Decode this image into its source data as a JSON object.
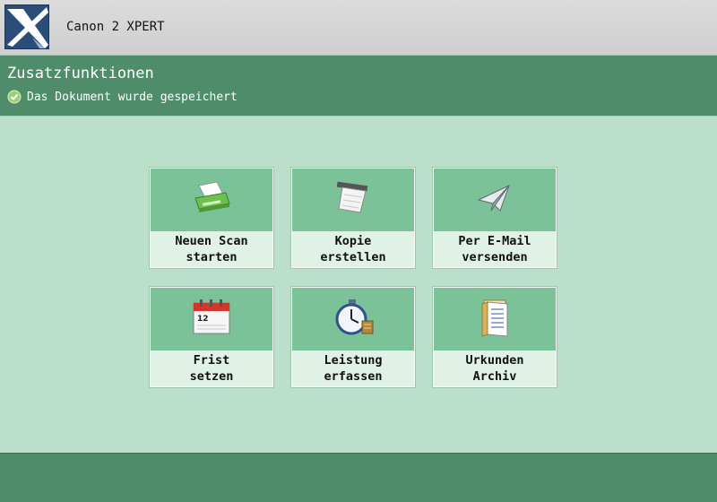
{
  "app": {
    "title": "Canon 2 XPERT",
    "logo_icon": "x-logo-icon"
  },
  "header": {
    "title": "Zusatzfunktionen",
    "status_icon": "check-circle-icon",
    "status_text": "Das Dokument wurde gespeichert"
  },
  "tiles": [
    {
      "label": "Neuen Scan\nstarten",
      "icon": "scanner-icon"
    },
    {
      "label": "Kopie\nerstellen",
      "icon": "copy-paper-icon"
    },
    {
      "label": "Per E-Mail\nversenden",
      "icon": "paper-plane-icon"
    },
    {
      "label": "Frist\nsetzen",
      "icon": "calendar-icon"
    },
    {
      "label": "Leistung\nerfassen",
      "icon": "stopwatch-icon"
    },
    {
      "label": "Urkunden\nArchiv",
      "icon": "archive-folder-icon"
    }
  ],
  "calendar_day": "12",
  "colors": {
    "header": "#4e8c6a",
    "tile_accent": "#7cc298",
    "background": "#bcdfcb"
  }
}
